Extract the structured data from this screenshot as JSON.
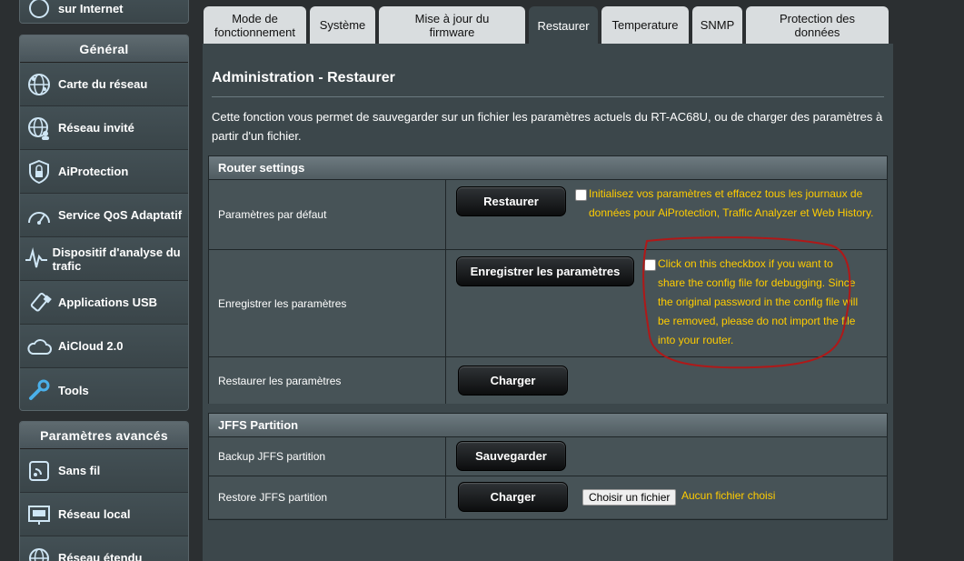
{
  "sidebar": {
    "top_partial_label": "sur Internet",
    "general": {
      "header": "Général",
      "items": [
        {
          "label": "Carte du réseau",
          "icon": "globe-network-icon"
        },
        {
          "label": "Réseau invité",
          "icon": "guest-network-icon"
        },
        {
          "label": "AiProtection",
          "icon": "shield-lock-icon"
        },
        {
          "label": "Service QoS Adaptatif",
          "icon": "speedometer-icon"
        },
        {
          "label": "Dispositif d'analyse du trafic",
          "icon": "traffic-analyzer-icon"
        },
        {
          "label": "Applications USB",
          "icon": "usb-icon"
        },
        {
          "label": "AiCloud 2.0",
          "icon": "cloud-icon"
        },
        {
          "label": "Tools",
          "icon": "wrench-icon"
        }
      ]
    },
    "advanced": {
      "header": "Paramètres avancés",
      "items": [
        {
          "label": "Sans fil",
          "icon": "wireless-icon"
        },
        {
          "label": "Réseau local",
          "icon": "lan-icon"
        },
        {
          "label": "Réseau étendu",
          "icon": "wan-globe-icon"
        }
      ]
    }
  },
  "tabs": [
    {
      "label": "Mode de fonctionnement",
      "active": false
    },
    {
      "label": "Système",
      "active": false
    },
    {
      "label": "Mise à jour du firmware",
      "active": false
    },
    {
      "label": "Restaurer",
      "active": true
    },
    {
      "label": "Temperature",
      "active": false
    },
    {
      "label": "SNMP",
      "active": false
    },
    {
      "label": "Protection des données",
      "active": false
    }
  ],
  "main": {
    "title": "Administration - Restaurer",
    "description": "Cette fonction vous permet de sauvegarder sur un fichier les paramètres actuels du RT-AC68U, ou de charger des paramètres à partir d'un fichier.",
    "router_settings": {
      "header": "Router settings",
      "default_row": {
        "label": "Paramètres par défaut",
        "button": "Restaurer",
        "note": "Initialisez vos paramètres et effacez tous les journaux de données pour AiProtection, Traffic Analyzer et Web History."
      },
      "save_row": {
        "label": "Enregistrer les paramètres",
        "button": "Enregistrer les paramètres",
        "note": "Click on this checkbox if you want to share the config file for debugging. Since the original password in the config file will be removed, please do not import the file into your router."
      },
      "restore_row": {
        "label": "Restaurer les paramètres",
        "button": "Charger"
      }
    },
    "jffs": {
      "header": "JFFS Partition",
      "backup_row": {
        "label": "Backup JFFS partition",
        "button": "Sauvegarder"
      },
      "restore_row": {
        "label": "Restore JFFS partition",
        "button": "Charger",
        "file_button": "Choisir un fichier",
        "file_status": "Aucun fichier choisi"
      }
    }
  },
  "colors": {
    "note_text": "#ffcc00",
    "annotation_circle": "#b01818",
    "panel_bg": "#3c474b"
  }
}
